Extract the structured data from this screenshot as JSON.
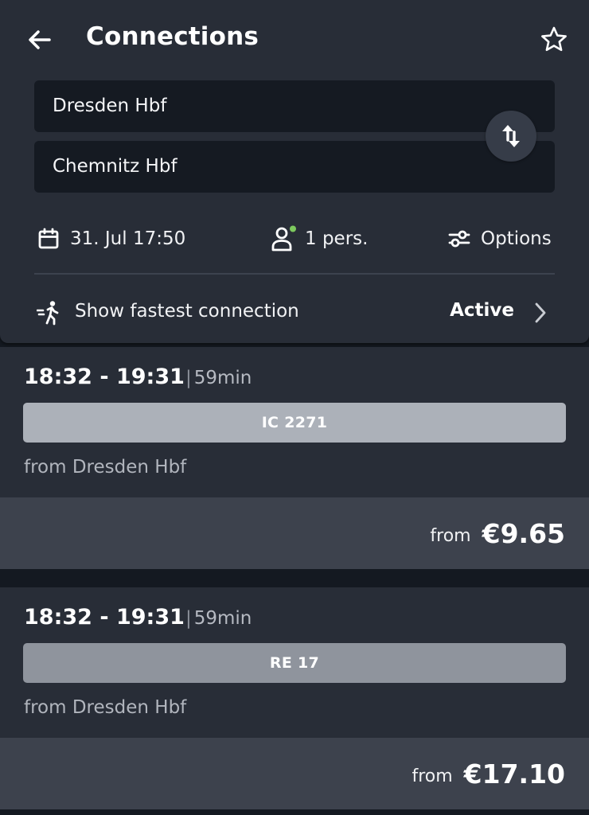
{
  "header": {
    "title": "Connections",
    "origin": "Dresden Hbf",
    "destination": "Chemnitz Hbf",
    "date_time": "31. Jul 17:50",
    "travelers": "1 pers.",
    "options_label": "Options",
    "fastest_label": "Show fastest connection",
    "fastest_status": "Active",
    "traveler_dot_color": "#7dc95e"
  },
  "connections": [
    {
      "times": "18:32 - 19:31",
      "duration": "59min",
      "train": "IC 2271",
      "from_station": "from Dresden Hbf",
      "price_prefix": "from",
      "price": "€9.65"
    },
    {
      "times": "18:32 - 19:31",
      "duration": "59min",
      "train": "RE 17",
      "from_station": "from Dresden Hbf",
      "price_prefix": "from",
      "price": "€17.10"
    }
  ],
  "icons": [
    "back-arrow-icon",
    "star-icon",
    "swap-icon",
    "calendar-icon",
    "person-icon",
    "sliders-icon",
    "walking-fast-icon",
    "chevron-right-icon"
  ]
}
